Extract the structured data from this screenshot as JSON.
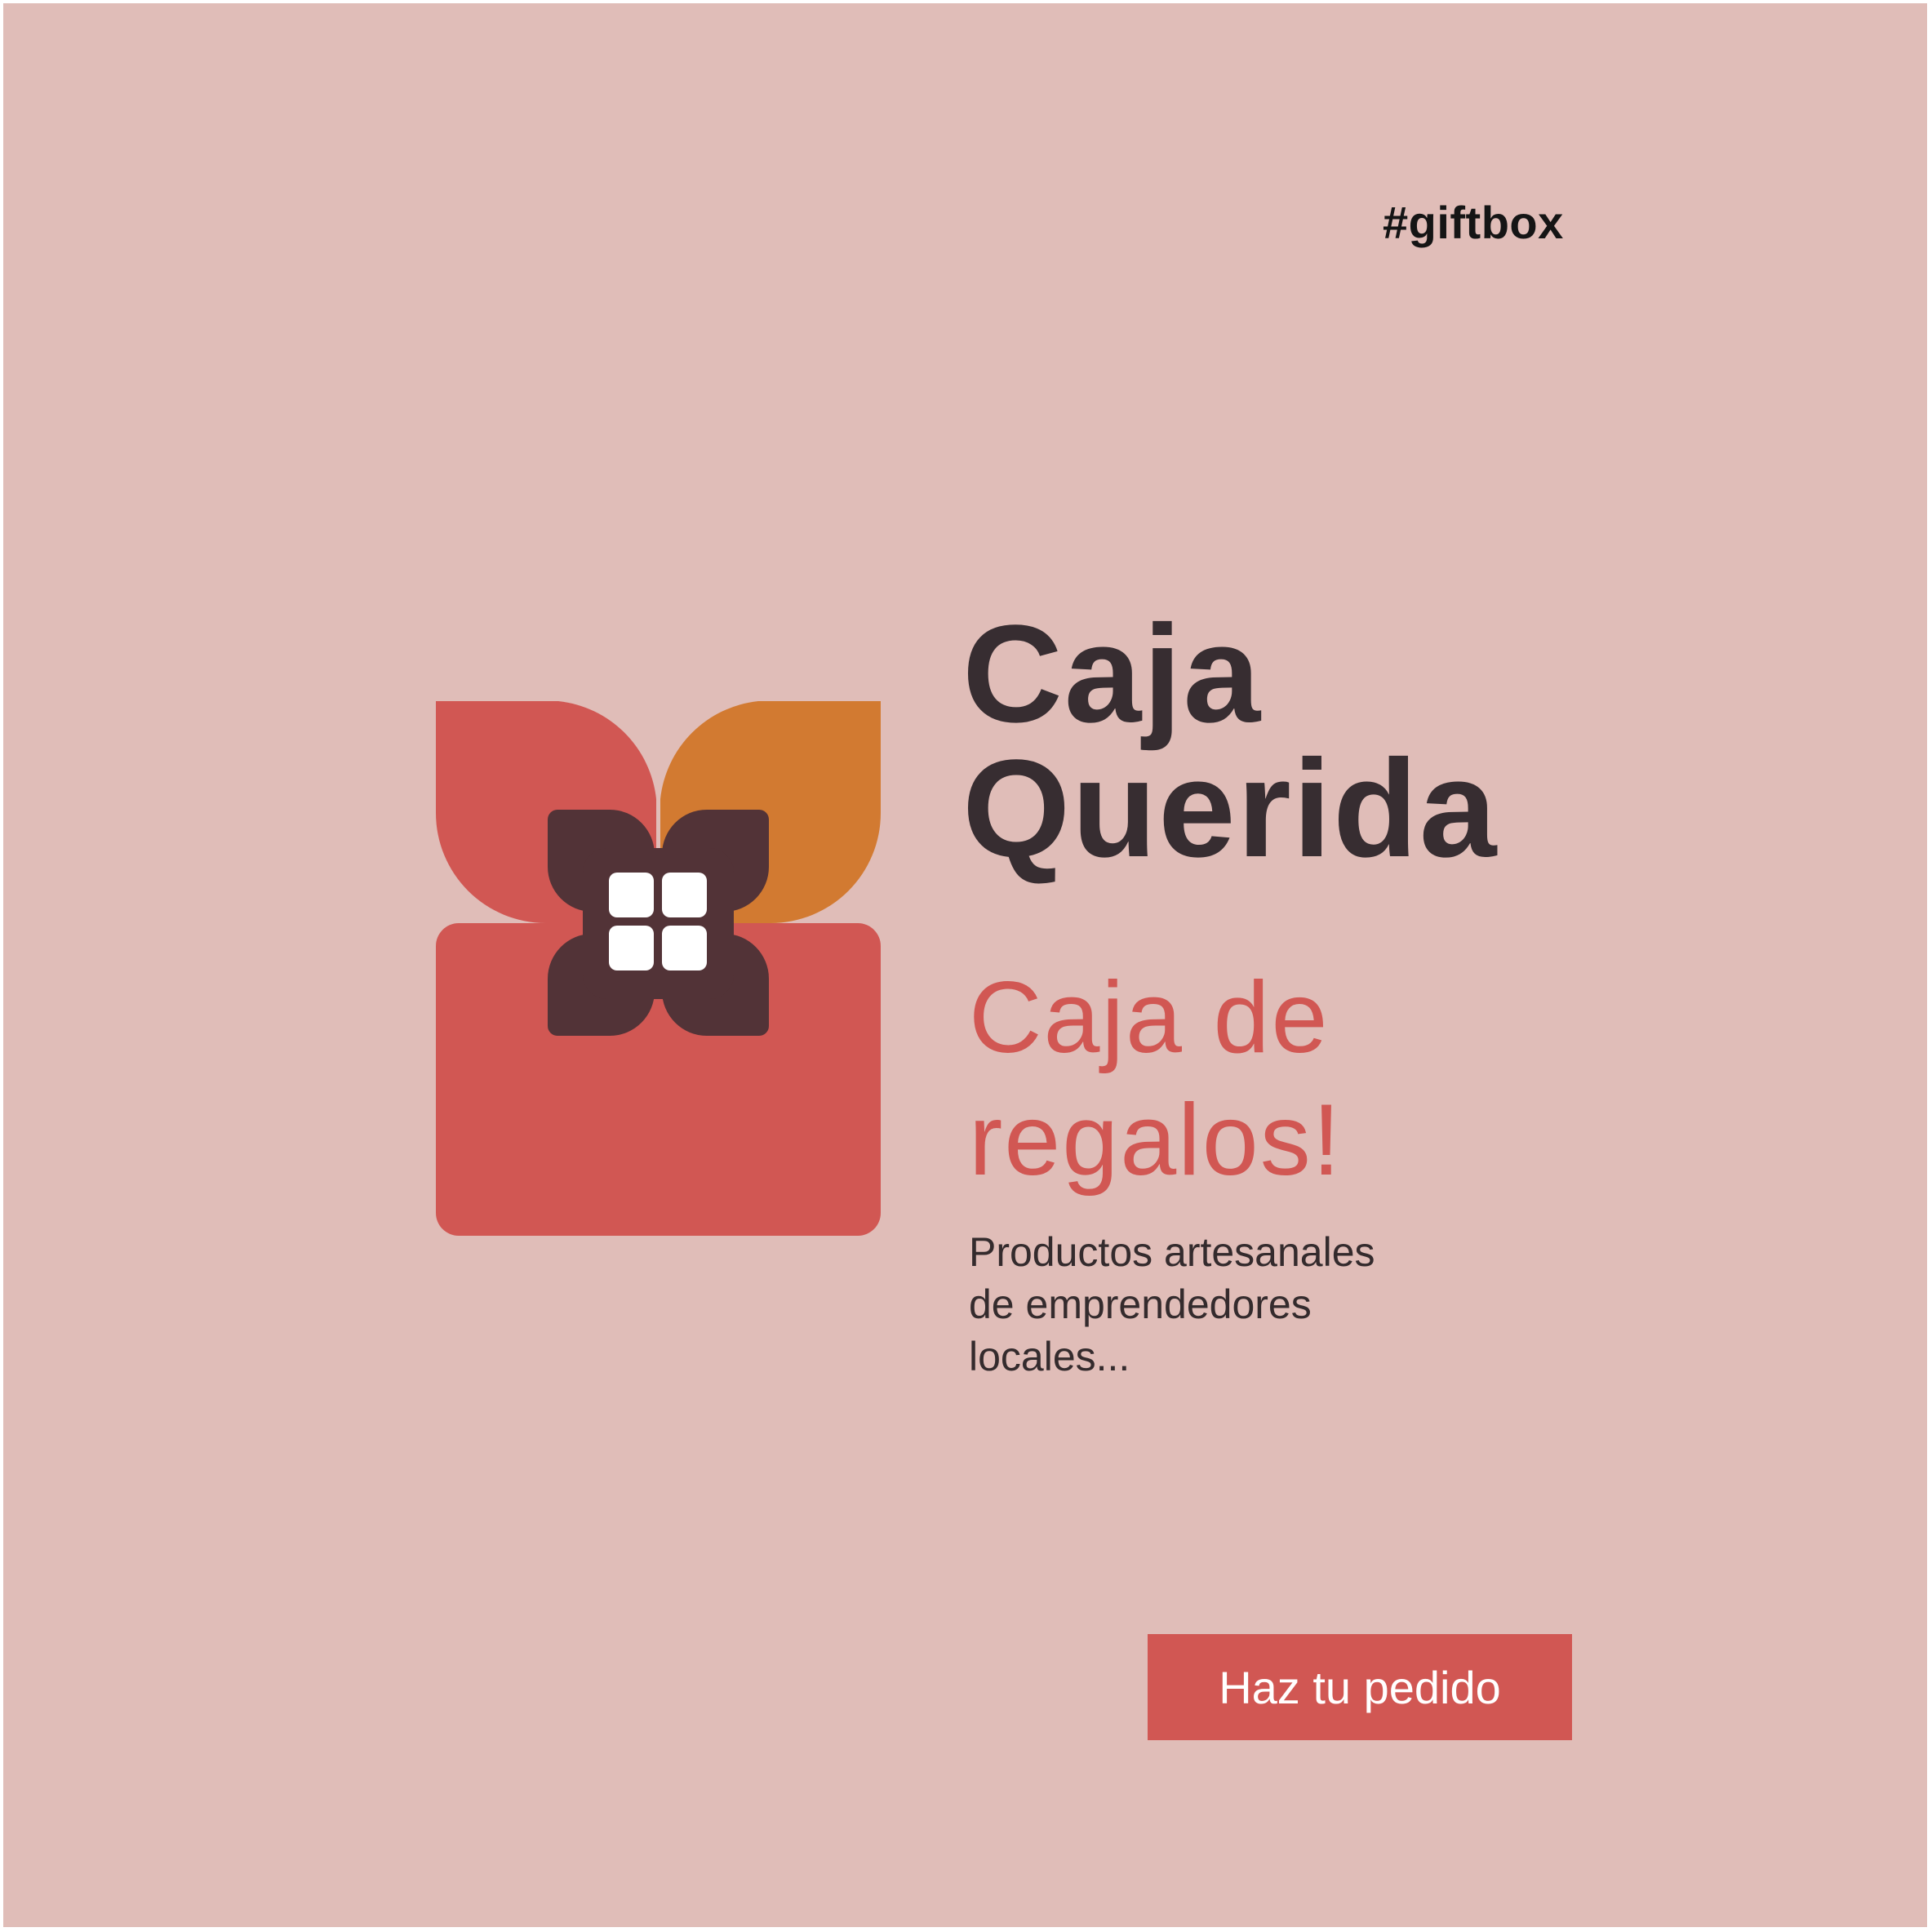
{
  "hashtag": "#giftbox",
  "brand": {
    "line1": "Caja",
    "line2": "Querida"
  },
  "headline": {
    "line1": "Caja de",
    "line2": "regalos!"
  },
  "description": {
    "line1": "Productos artesanales",
    "line2": "de emprendedores",
    "line3": "locales..."
  },
  "cta": {
    "label": "Haz tu pedido"
  },
  "colors": {
    "background": "#e0bdb8",
    "accent_red": "#d15753",
    "accent_orange": "#d27a31",
    "dark_plum": "#523337",
    "text_dark": "#372d31"
  },
  "logo": {
    "icon": "gift-box-flower-icon"
  }
}
